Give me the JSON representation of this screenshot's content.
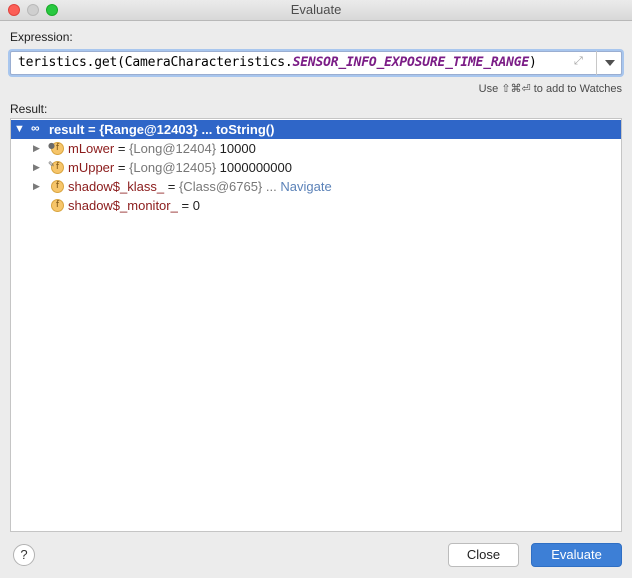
{
  "window": {
    "title": "Evaluate"
  },
  "expression": {
    "label": "Expression:",
    "prefix": "teristics.get(CameraCharacteristics.",
    "constant": "SENSOR_INFO_EXPOSURE_TIME_RANGE",
    "suffix": ")"
  },
  "hint": "Use ⇧⌘⏎ to add to Watches",
  "result": {
    "label": "Result:",
    "root": {
      "text": "result = {Range@12403} ... toString()"
    },
    "children": [
      {
        "name": "mLower",
        "type": "{Long@12404}",
        "value": "10000",
        "expandable": true,
        "link": ""
      },
      {
        "name": "mUpper",
        "type": "{Long@12405}",
        "value": "1000000000",
        "expandable": true,
        "link": ""
      },
      {
        "name": "shadow$_klass_",
        "type": "{Class@6765}",
        "value": "...",
        "expandable": true,
        "link": "Navigate"
      },
      {
        "name": "shadow$_monitor_",
        "type": "",
        "value": "0",
        "expandable": false,
        "link": ""
      }
    ]
  },
  "buttons": {
    "help": "?",
    "close": "Close",
    "evaluate": "Evaluate"
  },
  "colors": {
    "selection": "#2f66c8",
    "primary_button": "#3d7fd6",
    "constant": "#7b1c86",
    "field_name": "#8b1b1b"
  },
  "icons": [
    "close-window-icon",
    "minimize-window-icon",
    "maximize-window-icon",
    "expand-icon",
    "chevron-down-icon",
    "watch-glasses-icon",
    "field-icon"
  ]
}
